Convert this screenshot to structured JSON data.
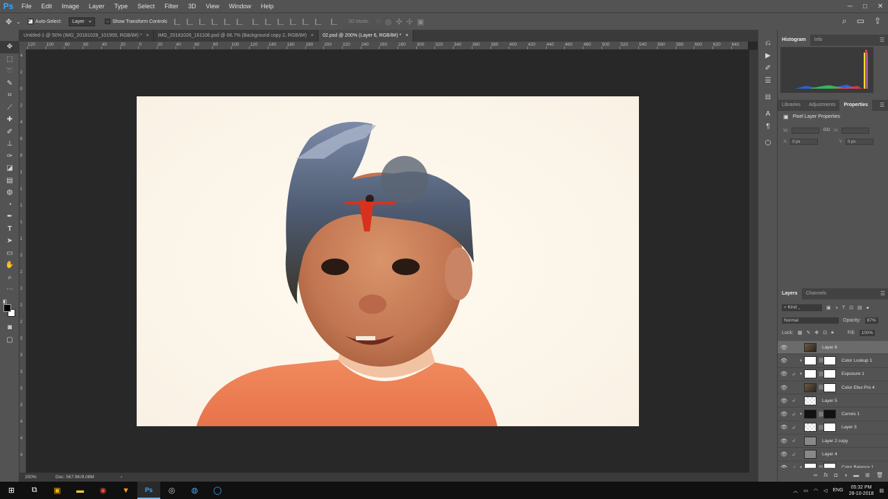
{
  "app": {
    "logo": "Ps",
    "menu": [
      "File",
      "Edit",
      "Image",
      "Layer",
      "Type",
      "Select",
      "Filter",
      "3D",
      "View",
      "Window",
      "Help"
    ],
    "window_controls": [
      "─",
      "□",
      "✕"
    ]
  },
  "options_bar": {
    "auto_select_label": "Auto-Select:",
    "auto_select_checked": true,
    "auto_select_target": "Layer",
    "show_transform_label": "Show Transform Controls",
    "show_transform_checked": false,
    "mode_3d_label": "3D Mode:"
  },
  "tabs": [
    {
      "title": "Untitled-1 @ 50% (IMG_20181028_101959, RGB/8#) *",
      "active": false
    },
    {
      "title": "IMG_20181026_161106.psd @ 66.7% (Background copy 2, RGB/8#)",
      "active": false
    },
    {
      "title": "02.psd @ 200% (Layer 6, RGB/8#) *",
      "active": true
    }
  ],
  "ruler_top_labels": [
    "120",
    "100",
    "80",
    "60",
    "40",
    "20",
    "0",
    "20",
    "40",
    "60",
    "80",
    "100",
    "120",
    "140",
    "160",
    "180",
    "200",
    "220",
    "240",
    "260",
    "280",
    "300",
    "320",
    "340",
    "360",
    "380",
    "400",
    "420",
    "440",
    "460",
    "480",
    "500",
    "520",
    "540",
    "560",
    "580",
    "600",
    "620",
    "640",
    "660",
    "680",
    "700",
    "720",
    "740"
  ],
  "ruler_left_labels": [
    "4",
    "2",
    "0",
    "2",
    "4",
    "6",
    "8",
    "1",
    "1",
    "1",
    "1",
    "1",
    "2",
    "2",
    "2",
    "2",
    "2",
    "3",
    "3",
    "3",
    "3",
    "3",
    "4",
    "4",
    "4"
  ],
  "status": {
    "zoom": "200%",
    "doc": "Doc: 567.9K/9.08M"
  },
  "panels": {
    "top_tabs": [
      "Histogram",
      "Info"
    ],
    "top_active": "Histogram",
    "mid_tabs": [
      "Libraries",
      "Adjustments",
      "Properties"
    ],
    "mid_active": "Properties",
    "properties_title": "Pixel Layer Properties",
    "w_label": "W:",
    "h_label": "H:",
    "x_label": "X:",
    "x_value": "0 px",
    "y_label": "Y:",
    "y_value": "0 px",
    "link_label": "GO"
  },
  "layers": {
    "tabs": [
      "Layers",
      "Channels"
    ],
    "active_tab": "Layers",
    "filter_kind": "Kind",
    "blend_mode": "Normal",
    "opacity_label": "Opacity:",
    "opacity_value": "67%",
    "lock_label": "Lock:",
    "fill_label": "Fill:",
    "fill_value": "100%",
    "items": [
      {
        "name": "Layer 6",
        "thumb": "photo",
        "selected": true,
        "clip": false,
        "adj": false,
        "mask": false
      },
      {
        "name": "Color Lookup 1",
        "thumb": "white",
        "selected": false,
        "clip": false,
        "adj": true,
        "mask": true
      },
      {
        "name": "Exposure 1",
        "thumb": "white",
        "selected": false,
        "clip": true,
        "adj": true,
        "mask": true
      },
      {
        "name": "Color Efex Pro 4",
        "thumb": "photo",
        "selected": false,
        "clip": false,
        "adj": false,
        "mask": true
      },
      {
        "name": "Layer 5",
        "thumb": "checker",
        "selected": false,
        "clip": true,
        "adj": false,
        "mask": false
      },
      {
        "name": "Curves 1",
        "thumb": "dark",
        "selected": false,
        "clip": true,
        "adj": true,
        "mask": true
      },
      {
        "name": "Layer 3",
        "thumb": "checker",
        "selected": false,
        "clip": true,
        "adj": false,
        "mask": true
      },
      {
        "name": "Layer 2 copy",
        "thumb": "grey",
        "selected": false,
        "clip": true,
        "adj": false,
        "mask": false
      },
      {
        "name": "Layer 4",
        "thumb": "grey",
        "selected": false,
        "clip": true,
        "adj": false,
        "mask": false
      },
      {
        "name": "Color Balance 1",
        "thumb": "white",
        "selected": false,
        "clip": true,
        "adj": true,
        "mask": true
      }
    ]
  },
  "taskbar": {
    "time": "05:32 PM",
    "date": "28-10-2018",
    "language": "ENG"
  }
}
